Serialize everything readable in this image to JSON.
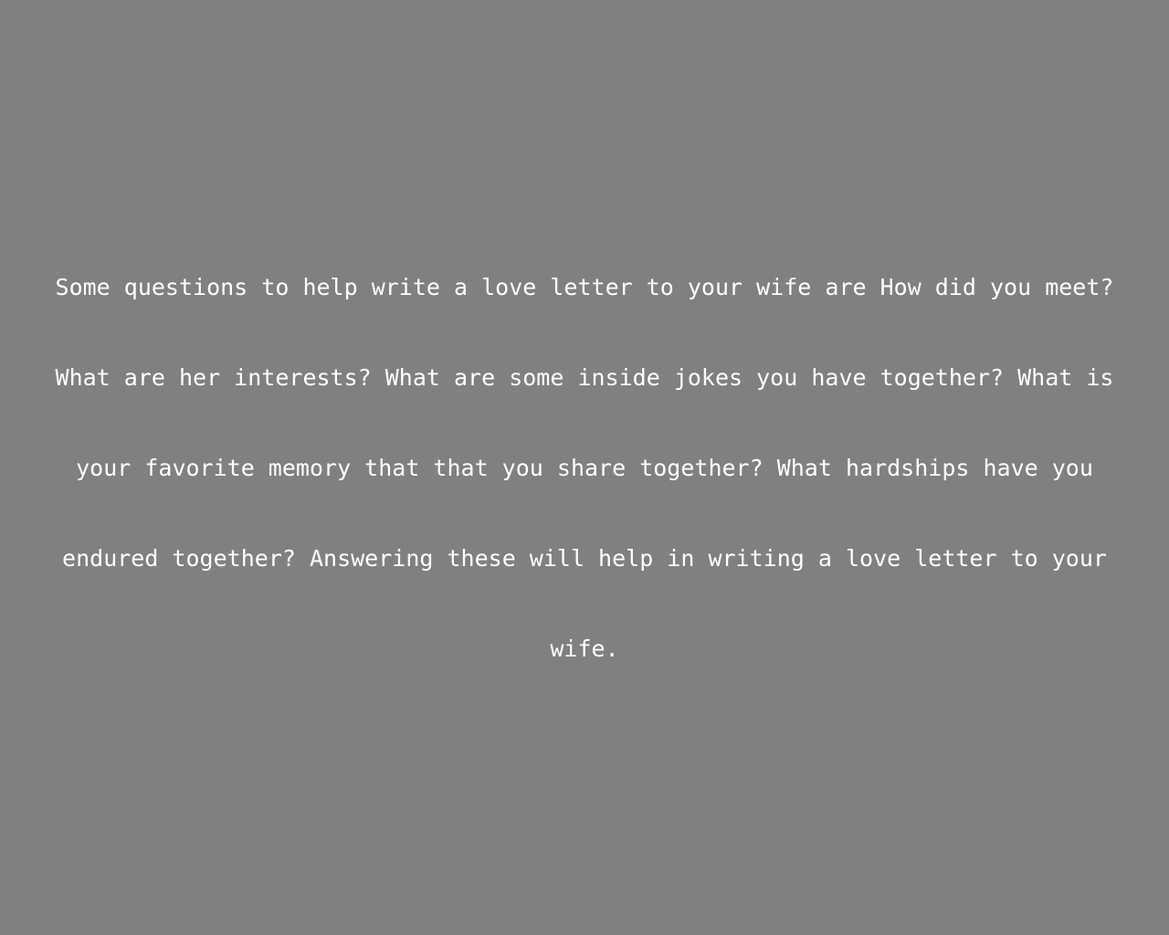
{
  "background_color": "#808080",
  "text_color": "#ffffff",
  "content": {
    "paragraph": "Some questions to help write a love letter to your wife are How did you meet? What are her interests? What are some inside jokes you have together? What is your favorite memory that that you share together? What hardships have you endured together? Answering these will help in writing a love letter to your wife."
  }
}
